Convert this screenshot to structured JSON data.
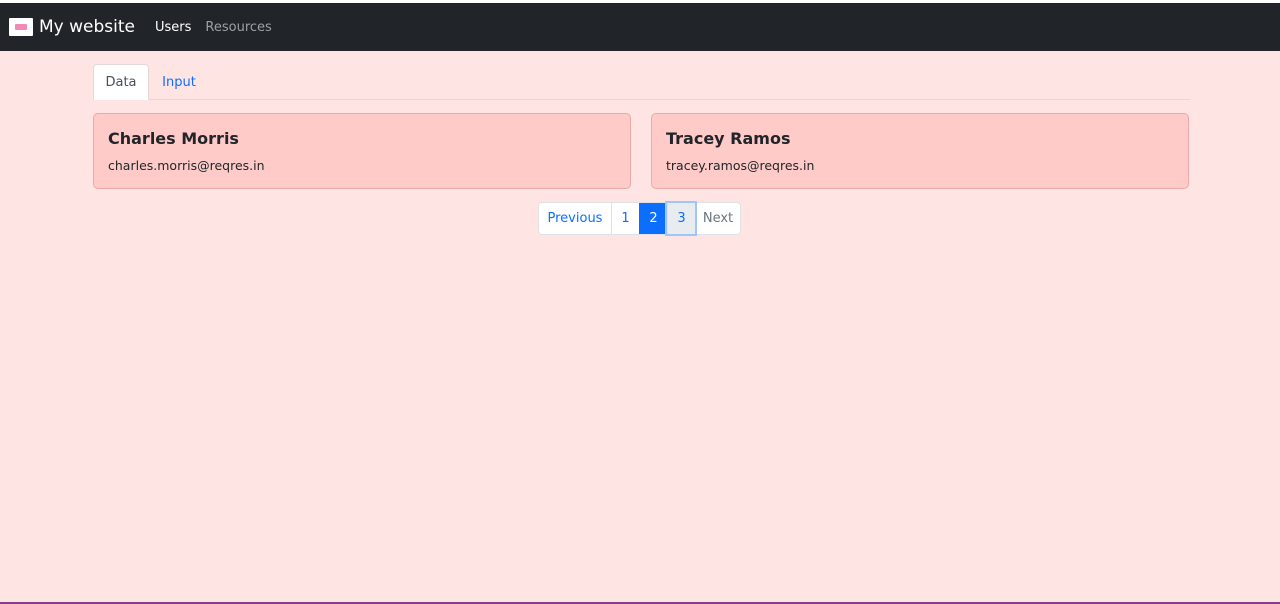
{
  "navbar": {
    "brand": "My website",
    "links": [
      {
        "label": "Users",
        "active": true
      },
      {
        "label": "Resources",
        "active": false
      }
    ]
  },
  "tabs": [
    {
      "label": "Data",
      "active": true
    },
    {
      "label": "Input",
      "active": false
    }
  ],
  "users": [
    {
      "name": "Charles Morris",
      "email": "charles.morris@reqres.in"
    },
    {
      "name": "Tracey Ramos",
      "email": "tracey.ramos@reqres.in"
    }
  ],
  "pagination": {
    "previous": "Previous",
    "pages": [
      "1",
      "2",
      "3"
    ],
    "current_page": "2",
    "next": "Next"
  },
  "colors": {
    "page_background": "#ffe4e4",
    "navbar": "#212529",
    "card_background": "#ffcbc9",
    "accent": "#0d6efd"
  }
}
